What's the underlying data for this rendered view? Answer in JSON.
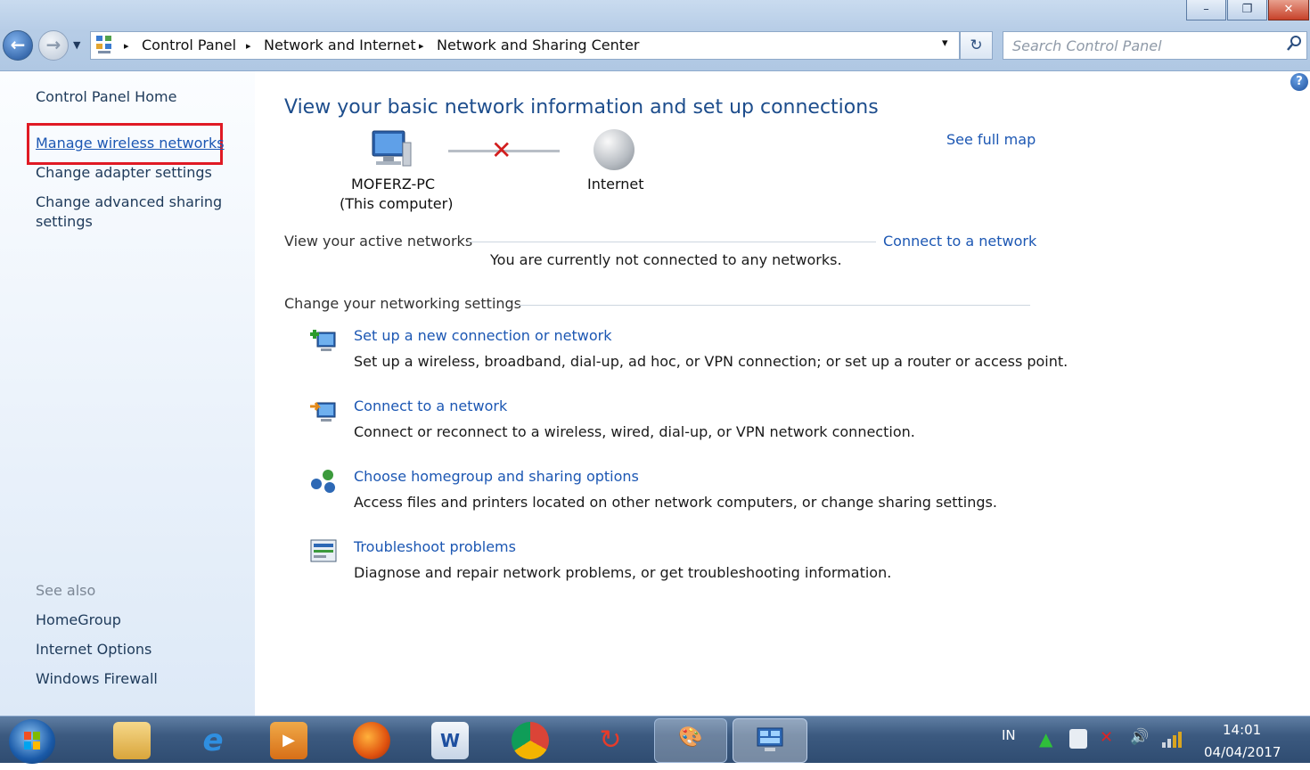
{
  "window": {
    "controls": {
      "minimize": "–",
      "maximize": "❐",
      "close": "✕"
    }
  },
  "address": {
    "root_icon": "control-panel-icon",
    "crumbs": [
      "Control Panel",
      "Network and Internet",
      "Network and Sharing Center"
    ],
    "separator": "▸",
    "dropdown": "▾",
    "refresh": "↻"
  },
  "search": {
    "placeholder": "Search Control Panel",
    "icon": "🔍"
  },
  "sidebar": {
    "home": "Control Panel Home",
    "links": [
      "Manage wireless networks",
      "Change adapter settings",
      "Change advanced sharing settings"
    ],
    "see_also_label": "See also",
    "see_also": [
      "HomeGroup",
      "Internet Options",
      "Windows Firewall"
    ]
  },
  "main": {
    "title": "View your basic network information and set up connections",
    "see_full_map": "See full map",
    "computer": {
      "name": "MOFERZ-PC",
      "sub": "(This computer)"
    },
    "internet": "Internet",
    "active_networks_label": "View your active networks",
    "connect_link": "Connect to a network",
    "not_connected": "You are currently not connected to any networks.",
    "settings_label": "Change your networking settings",
    "tasks": [
      {
        "title": "Set up a new connection or network",
        "desc": "Set up a wireless, broadband, dial-up, ad hoc, or VPN connection; or set up a router or access point."
      },
      {
        "title": "Connect to a network",
        "desc": "Connect or reconnect to a wireless, wired, dial-up, or VPN network connection."
      },
      {
        "title": "Choose homegroup and sharing options",
        "desc": "Access files and printers located on other network computers, or change sharing settings."
      },
      {
        "title": "Troubleshoot problems",
        "desc": "Diagnose and repair network problems, or get troubleshooting information."
      }
    ]
  },
  "taskbar": {
    "lang": "IN",
    "time": "14:01",
    "date": "04/04/2017"
  },
  "colors": {
    "highlight_box": "#e01a24",
    "link": "#1c57b3"
  }
}
